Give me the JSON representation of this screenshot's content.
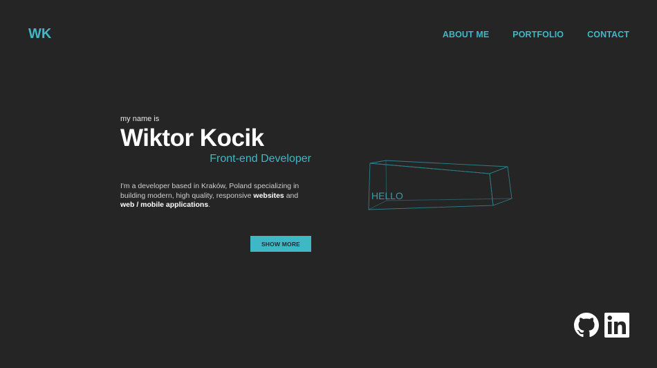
{
  "header": {
    "logo": "WK",
    "nav": [
      {
        "label": "ABOUT ME"
      },
      {
        "label": "PORTFOLIO"
      },
      {
        "label": "CONTACT"
      }
    ]
  },
  "hero": {
    "intro": "my name is",
    "name": "Wiktor Kocik",
    "role": "Front-end Developer",
    "bio_part1": "I'm a developer based in Kraków, Poland specializing in building modern, high quality, responsive ",
    "bio_bold1": "websites",
    "bio_part2": " and ",
    "bio_bold2": "web / mobile applications",
    "bio_part3": ".",
    "button": "SHOW MORE"
  },
  "box": {
    "label": "HELLO"
  },
  "social": {
    "icons": [
      "github-icon",
      "linkedin-icon"
    ]
  },
  "colors": {
    "accent": "#3fb8c6",
    "background": "#252525",
    "text": "#ffffff"
  }
}
